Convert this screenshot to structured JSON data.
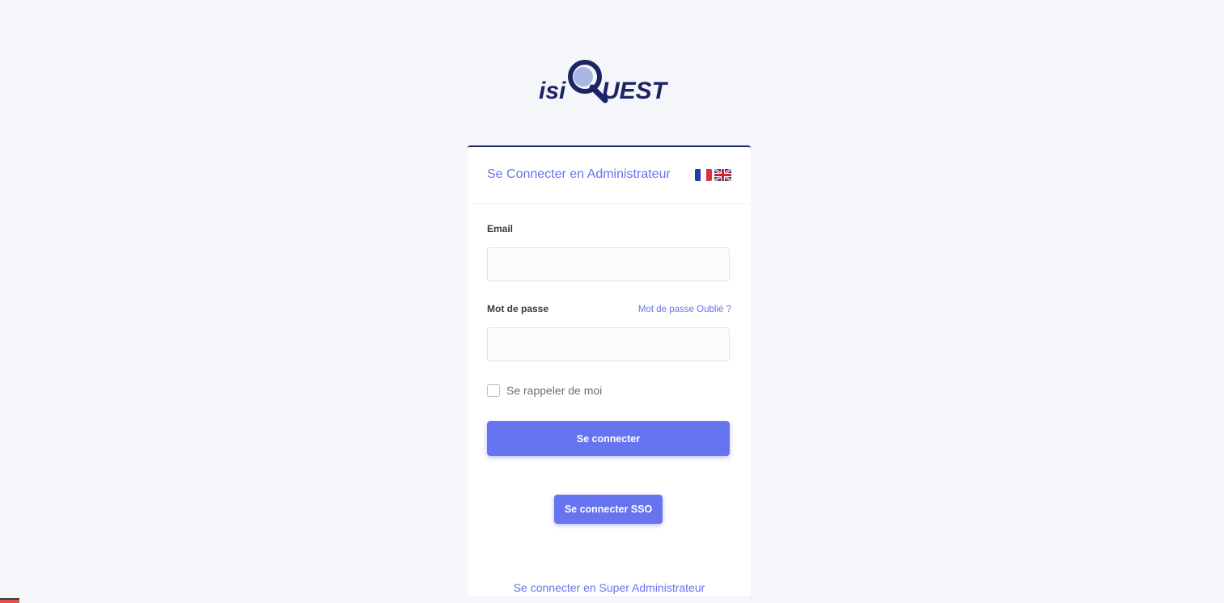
{
  "logo": {
    "prefix": "isi",
    "suffix": "UEST",
    "letter": "Q",
    "text_color": "#1c2466",
    "lens_color": "#8fa0d8"
  },
  "card": {
    "title": "Se Connecter en Administrateur",
    "languages": [
      {
        "code": "fr",
        "icon": "france-flag-icon"
      },
      {
        "code": "en",
        "icon": "uk-flag-icon"
      }
    ]
  },
  "form": {
    "email_label": "Email",
    "email_value": "",
    "password_label": "Mot de passe",
    "password_value": "",
    "forgot_link": "Mot de passe Oublié ?",
    "remember_label": "Se rappeler de moi",
    "remember_checked": false,
    "submit_label": "Se connecter",
    "sso_label": "Se connecter SSO",
    "super_admin_link": "Se connecter en Super Administrateur"
  },
  "colors": {
    "accent": "#6774ef",
    "brand_dark": "#1c2466",
    "background": "#f5f6fa"
  }
}
